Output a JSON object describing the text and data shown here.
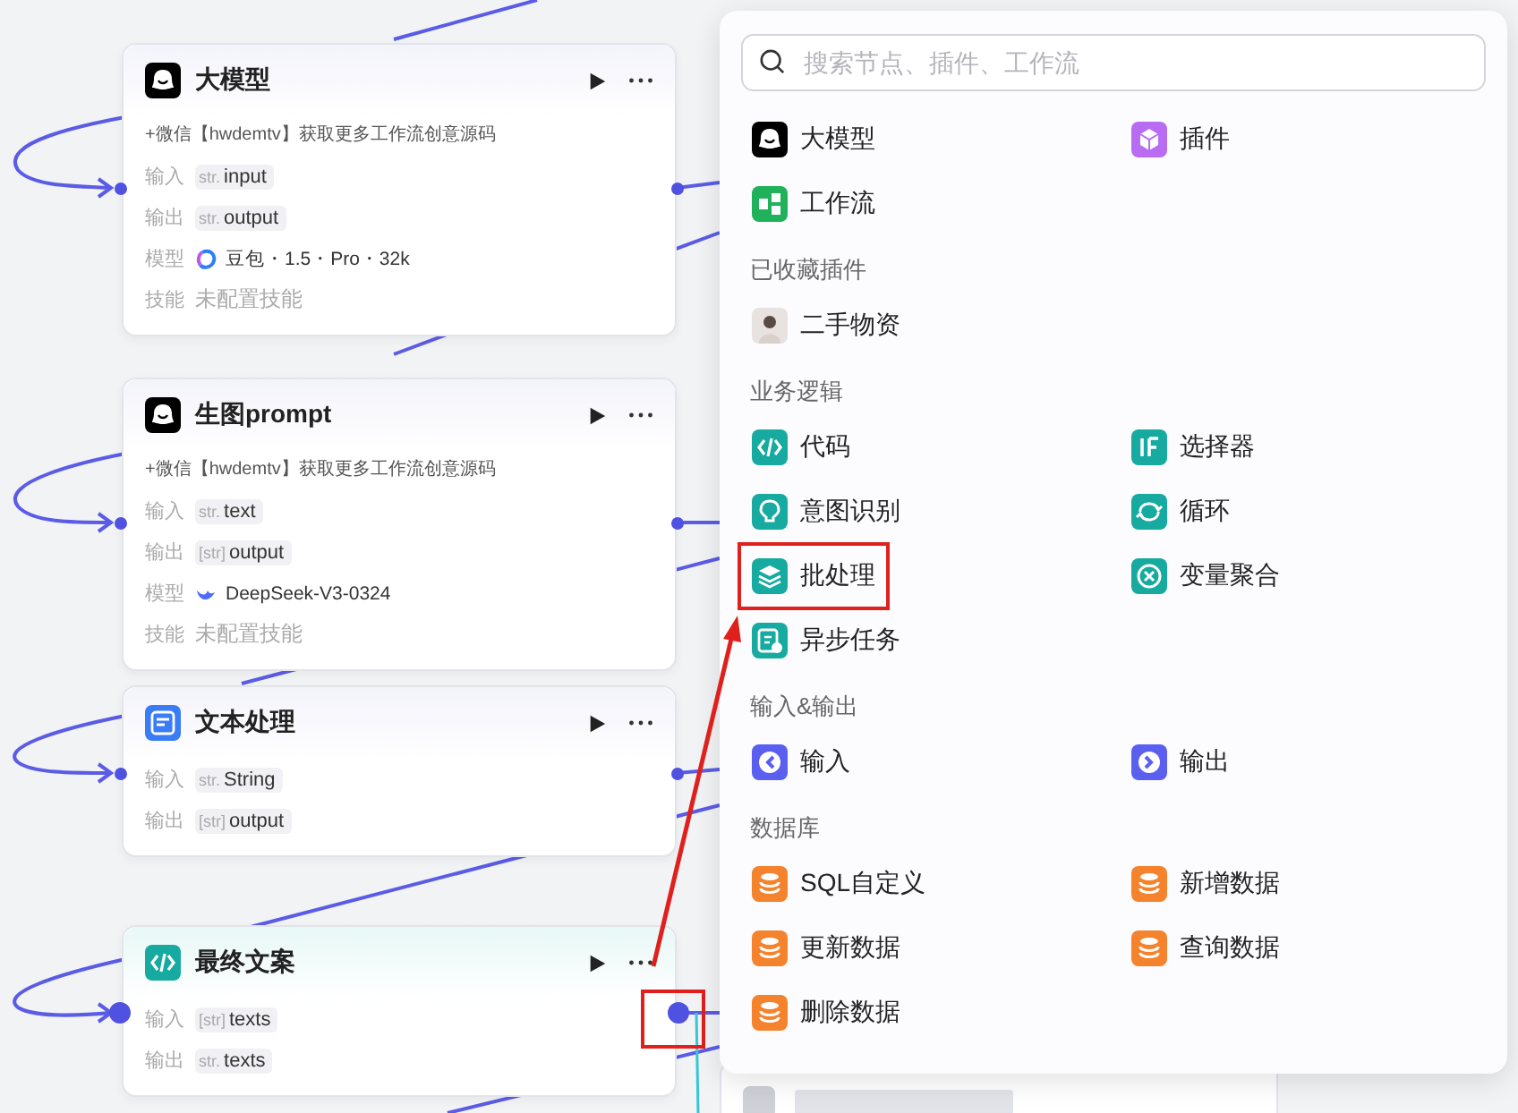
{
  "nodes": [
    {
      "title": "大模型",
      "kind": "llm",
      "active": false,
      "port_highlighted": false,
      "rows": [
        {
          "kind": "note",
          "text": "+微信【hwdemtv】获取更多工作流创意源码"
        },
        {
          "kind": "param",
          "label": "输入",
          "tag": "str.",
          "value": "input"
        },
        {
          "kind": "param",
          "label": "输出",
          "tag": "str.",
          "value": "output"
        },
        {
          "kind": "model",
          "label": "模型",
          "value": "豆包・1.5・Pro・32k"
        },
        {
          "kind": "skill",
          "label": "技能",
          "value": "未配置技能"
        }
      ]
    },
    {
      "title": "生图prompt",
      "kind": "llm",
      "active": false,
      "port_highlighted": false,
      "rows": [
        {
          "kind": "note",
          "text": "+微信【hwdemtv】获取更多工作流创意源码"
        },
        {
          "kind": "param",
          "label": "输入",
          "tag": "str.",
          "value": "text"
        },
        {
          "kind": "param",
          "label": "输出",
          "tag": "[str]",
          "value": "output"
        },
        {
          "kind": "model",
          "label": "模型",
          "value": "DeepSeek-V3-0324"
        },
        {
          "kind": "skill",
          "label": "技能",
          "value": "未配置技能"
        }
      ]
    },
    {
      "title": "文本处理",
      "kind": "text",
      "active": false,
      "port_highlighted": false,
      "rows": [
        {
          "kind": "param",
          "label": "输入",
          "tag": "str.",
          "value": "String"
        },
        {
          "kind": "param",
          "label": "输出",
          "tag": "[str]",
          "value": "output"
        }
      ]
    },
    {
      "title": "最终文案",
      "kind": "code",
      "active": true,
      "port_highlighted": true,
      "rows": [
        {
          "kind": "param",
          "label": "输入",
          "tag": "[str]",
          "value": "texts"
        },
        {
          "kind": "param",
          "label": "输出",
          "tag": "str.",
          "value": "texts"
        }
      ]
    }
  ],
  "menu": {
    "search": {
      "placeholder": "搜索节点、插件、工作流"
    },
    "sections": [
      {
        "items": [
          {
            "label": "大模型",
            "kind": "llm",
            "color": "#000000",
            "highlighted": false
          },
          {
            "label": "插件",
            "kind": "plugin",
            "color": "#b76cf2",
            "highlighted": false
          },
          {
            "label": "工作流",
            "kind": "workflow",
            "color": "#20b25a",
            "highlighted": false
          }
        ]
      },
      {
        "title": "已收藏插件",
        "items": [
          {
            "label": "二手物资",
            "kind": "avatar",
            "color": "#e8e2e0",
            "highlighted": false
          }
        ]
      },
      {
        "title": "业务逻辑",
        "items": [
          {
            "label": "代码",
            "kind": "code",
            "color": "#16aaa0",
            "highlighted": false
          },
          {
            "label": "选择器",
            "kind": "if",
            "color": "#16aaa0",
            "highlighted": false
          },
          {
            "label": "意图识别",
            "kind": "intent",
            "color": "#16aaa0",
            "highlighted": false
          },
          {
            "label": "循环",
            "kind": "loop",
            "color": "#16aaa0",
            "highlighted": false
          },
          {
            "label": "批处理",
            "kind": "batch",
            "color": "#16aaa0",
            "highlighted": true
          },
          {
            "label": "变量聚合",
            "kind": "aggregate",
            "color": "#16aaa0",
            "highlighted": false
          },
          {
            "label": "异步任务",
            "kind": "async",
            "color": "#16aaa0",
            "highlighted": false
          }
        ]
      },
      {
        "title": "输入&输出",
        "items": [
          {
            "label": "输入",
            "kind": "input",
            "color": "#5a5ff0",
            "highlighted": false
          },
          {
            "label": "输出",
            "kind": "output",
            "color": "#5a5ff0",
            "highlighted": false
          }
        ]
      },
      {
        "title": "数据库",
        "items": [
          {
            "label": "SQL自定义",
            "kind": "db",
            "color": "#f5822c",
            "highlighted": false
          },
          {
            "label": "新增数据",
            "kind": "db",
            "color": "#f5822c",
            "highlighted": false
          },
          {
            "label": "更新数据",
            "kind": "db",
            "color": "#f5822c",
            "highlighted": false
          },
          {
            "label": "查询数据",
            "kind": "db",
            "color": "#f5822c",
            "highlighted": false
          },
          {
            "label": "删除数据",
            "kind": "db",
            "color": "#f5822c",
            "highlighted": false
          }
        ]
      }
    ]
  }
}
